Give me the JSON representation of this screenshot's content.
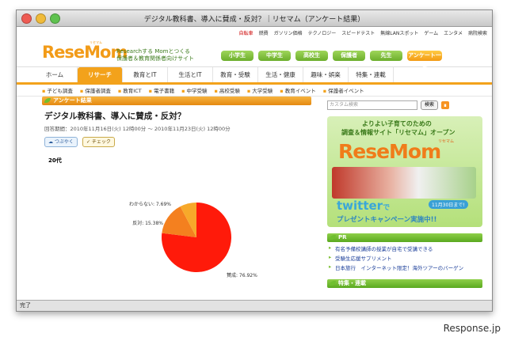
{
  "window": {
    "title": "デジタル教科書、導入に賛成・反対？｜リセマム（アンケート結果）",
    "status": "完了"
  },
  "topnav": [
    "自転車",
    "燃費",
    "ガソリン価格",
    "テクノロジー",
    "スピードテスト",
    "無線LANスポット",
    "ゲーム",
    "エンタメ",
    "病院検索"
  ],
  "brand": {
    "logo": "ReseMom",
    "ruby": "リセマム",
    "tagline1": "Researchする Momとつくる",
    "tagline2": "保護者＆教育関係者向けサイト"
  },
  "category_buttons": [
    "小学生",
    "中学生",
    "高校生",
    "保護者",
    "先生",
    "アンケート一覧"
  ],
  "main_nav": [
    "ホーム",
    "リサーチ",
    "教育とIT",
    "生活とIT",
    "教育・受験",
    "生活・健康",
    "趣味・娯楽",
    "特集・連載"
  ],
  "sub_nav": [
    "子ども調査",
    "保護者調査",
    "教育ICT",
    "電子書籍",
    "中学受験",
    "高校受験",
    "大学受験",
    "教育イベント",
    "保護者イベント"
  ],
  "section_header": "アンケート結果",
  "poll": {
    "title": "デジタル教科書、導入に賛成・反対？",
    "period": "回答期間：2010年11月16日(火) 12時00分 〜 2010年11月23日(火) 12時00分",
    "share_label": "つぶやく",
    "check_label": "チェック",
    "age_label": "20代"
  },
  "chart_data": {
    "type": "pie",
    "categories": [
      "賛成",
      "反対",
      "わからない"
    ],
    "values": [
      76.92,
      15.38,
      7.69
    ],
    "labels": [
      "賛成: 76.92%",
      "反対: 15.38%",
      "わからない: 7.69%"
    ],
    "colors": [
      "#ff1a0a",
      "#f4801f",
      "#f7a92a"
    ]
  },
  "search": {
    "placeholder": "カスタム検索",
    "button": "検索"
  },
  "banner": {
    "line1": "よりよい子育てのための",
    "line2": "調査＆情報サイト「リセマム」オープン",
    "logo": "ReseMom",
    "ruby": "リセマム",
    "twitter": "twitter",
    "twitter_suffix": "で",
    "badge": "11月30日まで!",
    "campaign": "プレゼントキャンペーン実施中!!"
  },
  "pr": {
    "header": "PR",
    "items": [
      "有名予備校講師の授業が自宅で受講できる",
      "受験生応援サプリメント",
      "日本旅行　インターネット限定！海外ツアーのバーゲン"
    ]
  },
  "bottom_header": "特集・連載",
  "watermark": "Response.jp"
}
